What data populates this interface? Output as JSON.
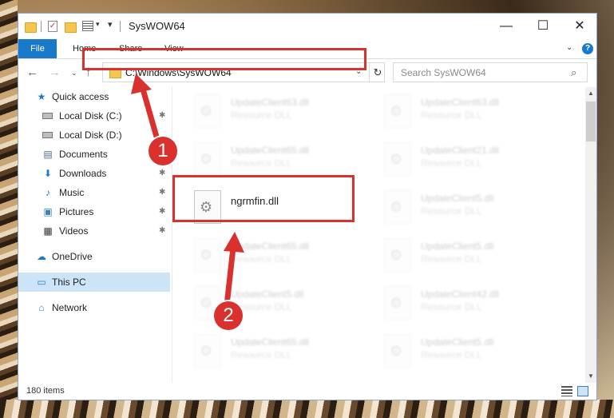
{
  "window": {
    "title": "SysWOW64",
    "controls": {
      "minimize": "—",
      "maximize": "☐",
      "close": "✕"
    }
  },
  "quick_access_toolbar": {
    "dropdown": "▾",
    "pin": "▾"
  },
  "ribbon": {
    "tabs": [
      {
        "label": "File",
        "active": true
      },
      {
        "label": "Home"
      },
      {
        "label": "Share"
      },
      {
        "label": "View"
      }
    ],
    "expand": "⌄",
    "help": "?"
  },
  "navigation": {
    "back": "←",
    "forward": "→",
    "recent": "⌄",
    "up": "↑",
    "address": "C:\\Windows\\SysWOW64",
    "address_dropdown": "⌄",
    "refresh": "↻",
    "search_placeholder": "Search SysWOW64",
    "search_icon": "⌕"
  },
  "nav_pane": {
    "items": [
      {
        "label": "Quick access",
        "icon": "star-icon",
        "glyph": "★",
        "pinned": false
      },
      {
        "label": "Local Disk (C:)",
        "icon": "drive-icon",
        "glyph": "",
        "pinned": true
      },
      {
        "label": "Local Disk (D:)",
        "icon": "drive-icon",
        "glyph": "",
        "pinned": false
      },
      {
        "label": "Documents",
        "icon": "document-icon",
        "glyph": "▤",
        "pinned": true
      },
      {
        "label": "Downloads",
        "icon": "download-icon",
        "glyph": "⬇",
        "pinned": true
      },
      {
        "label": "Music",
        "icon": "music-icon",
        "glyph": "♪",
        "pinned": true
      },
      {
        "label": "Pictures",
        "icon": "pictures-icon",
        "glyph": "▣",
        "pinned": true
      },
      {
        "label": "Videos",
        "icon": "videos-icon",
        "glyph": "▦",
        "pinned": true
      },
      {
        "label": "OneDrive",
        "icon": "cloud-icon",
        "glyph": "☁",
        "pinned": false
      },
      {
        "label": "This PC",
        "icon": "computer-icon",
        "glyph": "▭",
        "pinned": false,
        "selected": true
      },
      {
        "label": "Network",
        "icon": "network-icon",
        "glyph": "⌂",
        "pinned": false
      }
    ],
    "pin_glyph": "📌"
  },
  "files": [
    {
      "name": "UpdateClient63.dll",
      "type": "Resource DLL",
      "faded": true
    },
    {
      "name": "UpdateClient63.dll",
      "type": "Resource DLL",
      "faded": true
    },
    {
      "name": "UpdateClient65.dll",
      "type": "Resource DLL",
      "faded": true
    },
    {
      "name": "UpdateClient21.dll",
      "type": "Resource DLL",
      "faded": true
    },
    {
      "name": "ngrmfin.dll",
      "type": "",
      "faded": false
    },
    {
      "name": "UpdateClient5.dll",
      "type": "Resource DLL",
      "faded": true
    },
    {
      "name": "UpdateClient65.dll",
      "type": "Resource DLL",
      "faded": true
    },
    {
      "name": "UpdateClient5.dll",
      "type": "Resource DLL",
      "faded": true
    },
    {
      "name": "UpdateClient5.dll",
      "type": "Resource DLL",
      "faded": true
    },
    {
      "name": "UpdateClient42.dll",
      "type": "Resource DLL",
      "faded": true
    },
    {
      "name": "UpdateClient65.dll",
      "type": "Resource DLL",
      "faded": true
    },
    {
      "name": "UpdateClient5.dll",
      "type": "Resource DLL",
      "faded": true
    }
  ],
  "status": {
    "item_count": "180 items"
  },
  "scrollbar": {
    "up": "▲",
    "down": "▼"
  },
  "annotations": {
    "callout_1": "1",
    "callout_2": "2",
    "highlight_color": "#d9312e"
  },
  "colors": {
    "accent": "#1979ca",
    "selection": "#cce4f7",
    "folder": "#f3c74f"
  }
}
